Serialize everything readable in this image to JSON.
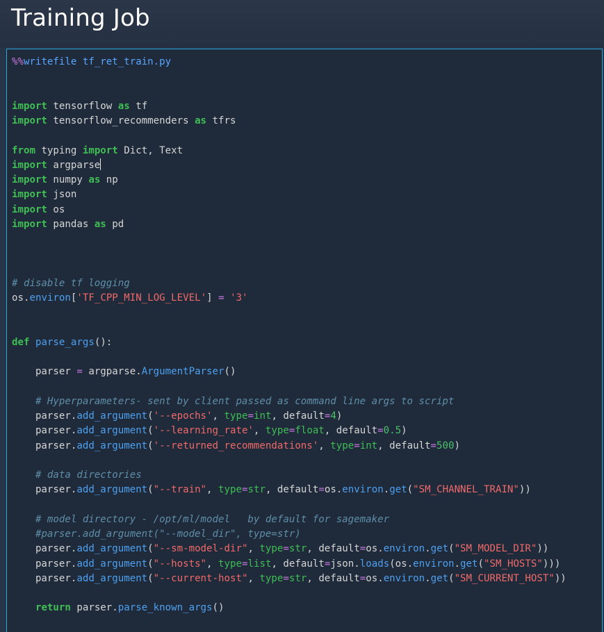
{
  "header": {
    "title": "Training Job"
  },
  "colors": {
    "background": "#283447",
    "cell_background": "#1f2a3a",
    "cell_border": "#2aa7d9",
    "keyword": "#3fbf54",
    "string": "#f06a6a",
    "comment": "#5f8fa8",
    "function": "#4ea1f0"
  },
  "code_cell": {
    "cursor_line": 7,
    "lines": [
      [
        [
          "magic",
          "%%"
        ],
        [
          "magicname",
          "writefile tf_ret_train.py"
        ]
      ],
      [],
      [],
      [
        [
          "kw",
          "import"
        ],
        [
          "plain",
          " tensorflow "
        ],
        [
          "kw",
          "as"
        ],
        [
          "plain",
          " tf"
        ]
      ],
      [
        [
          "kw",
          "import"
        ],
        [
          "plain",
          " tensorflow_recommenders "
        ],
        [
          "kw",
          "as"
        ],
        [
          "plain",
          " tfrs"
        ]
      ],
      [],
      [
        [
          "kw",
          "from"
        ],
        [
          "plain",
          " typing "
        ],
        [
          "kw",
          "import"
        ],
        [
          "plain",
          " Dict, Text"
        ]
      ],
      [
        [
          "kw",
          "import"
        ],
        [
          "plain",
          " argparse"
        ]
      ],
      [
        [
          "kw",
          "import"
        ],
        [
          "plain",
          " numpy "
        ],
        [
          "kw",
          "as"
        ],
        [
          "plain",
          " np"
        ]
      ],
      [
        [
          "kw",
          "import"
        ],
        [
          "plain",
          " json"
        ]
      ],
      [
        [
          "kw",
          "import"
        ],
        [
          "plain",
          " os"
        ]
      ],
      [
        [
          "kw",
          "import"
        ],
        [
          "plain",
          " pandas "
        ],
        [
          "kw",
          "as"
        ],
        [
          "plain",
          " pd"
        ]
      ],
      [],
      [],
      [],
      [
        [
          "comment",
          "# disable tf logging"
        ]
      ],
      [
        [
          "plain",
          "os"
        ],
        [
          "plain",
          "."
        ],
        [
          "fn",
          "environ"
        ],
        [
          "plain",
          "["
        ],
        [
          "str",
          "'TF_CPP_MIN_LOG_LEVEL'"
        ],
        [
          "plain",
          "] "
        ],
        [
          "op",
          "="
        ],
        [
          "plain",
          " "
        ],
        [
          "str",
          "'3'"
        ]
      ],
      [],
      [],
      [
        [
          "kw",
          "def"
        ],
        [
          "plain",
          " "
        ],
        [
          "fn",
          "parse_args"
        ],
        [
          "plain",
          "():"
        ]
      ],
      [],
      [
        [
          "plain",
          "    parser "
        ],
        [
          "op",
          "="
        ],
        [
          "plain",
          " argparse."
        ],
        [
          "fn",
          "ArgumentParser"
        ],
        [
          "plain",
          "()"
        ]
      ],
      [],
      [
        [
          "plain",
          "    "
        ],
        [
          "comment",
          "# Hyperparameters- sent by client passed as command line args to script"
        ]
      ],
      [
        [
          "plain",
          "    parser."
        ],
        [
          "fn",
          "add_argument"
        ],
        [
          "plain",
          "("
        ],
        [
          "str",
          "'--epochs'"
        ],
        [
          "plain",
          ", "
        ],
        [
          "builtin",
          "type"
        ],
        [
          "op",
          "="
        ],
        [
          "builtin",
          "int"
        ],
        [
          "plain",
          ", default"
        ],
        [
          "op",
          "="
        ],
        [
          "num",
          "4"
        ],
        [
          "plain",
          ")"
        ]
      ],
      [
        [
          "plain",
          "    parser."
        ],
        [
          "fn",
          "add_argument"
        ],
        [
          "plain",
          "("
        ],
        [
          "str",
          "'--learning_rate'"
        ],
        [
          "plain",
          ", "
        ],
        [
          "builtin",
          "type"
        ],
        [
          "op",
          "="
        ],
        [
          "builtin",
          "float"
        ],
        [
          "plain",
          ", default"
        ],
        [
          "op",
          "="
        ],
        [
          "num",
          "0.5"
        ],
        [
          "plain",
          ")"
        ]
      ],
      [
        [
          "plain",
          "    parser."
        ],
        [
          "fn",
          "add_argument"
        ],
        [
          "plain",
          "("
        ],
        [
          "str",
          "'--returned_recommendations'"
        ],
        [
          "plain",
          ", "
        ],
        [
          "builtin",
          "type"
        ],
        [
          "op",
          "="
        ],
        [
          "builtin",
          "int"
        ],
        [
          "plain",
          ", default"
        ],
        [
          "op",
          "="
        ],
        [
          "num",
          "500"
        ],
        [
          "plain",
          ")"
        ]
      ],
      [],
      [
        [
          "plain",
          "    "
        ],
        [
          "comment",
          "# data directories"
        ]
      ],
      [
        [
          "plain",
          "    parser."
        ],
        [
          "fn",
          "add_argument"
        ],
        [
          "plain",
          "("
        ],
        [
          "str",
          "\"--train\""
        ],
        [
          "plain",
          ", "
        ],
        [
          "builtin",
          "type"
        ],
        [
          "op",
          "="
        ],
        [
          "builtin",
          "str"
        ],
        [
          "plain",
          ", default"
        ],
        [
          "op",
          "="
        ],
        [
          "plain",
          "os."
        ],
        [
          "fn",
          "environ"
        ],
        [
          "plain",
          "."
        ],
        [
          "fn",
          "get"
        ],
        [
          "plain",
          "("
        ],
        [
          "str",
          "\"SM_CHANNEL_TRAIN\""
        ],
        [
          "plain",
          "))"
        ]
      ],
      [],
      [
        [
          "plain",
          "    "
        ],
        [
          "comment",
          "# model directory - /opt/ml/model   by default for sagemaker"
        ]
      ],
      [
        [
          "plain",
          "    "
        ],
        [
          "comment",
          "#parser.add_argument(\"--model_dir\", type=str)"
        ]
      ],
      [
        [
          "plain",
          "    parser."
        ],
        [
          "fn",
          "add_argument"
        ],
        [
          "plain",
          "("
        ],
        [
          "str",
          "\"--sm-model-dir\""
        ],
        [
          "plain",
          ", "
        ],
        [
          "builtin",
          "type"
        ],
        [
          "op",
          "="
        ],
        [
          "builtin",
          "str"
        ],
        [
          "plain",
          ", default"
        ],
        [
          "op",
          "="
        ],
        [
          "plain",
          "os."
        ],
        [
          "fn",
          "environ"
        ],
        [
          "plain",
          "."
        ],
        [
          "fn",
          "get"
        ],
        [
          "plain",
          "("
        ],
        [
          "str",
          "\"SM_MODEL_DIR\""
        ],
        [
          "plain",
          "))"
        ]
      ],
      [
        [
          "plain",
          "    parser."
        ],
        [
          "fn",
          "add_argument"
        ],
        [
          "plain",
          "("
        ],
        [
          "str",
          "\"--hosts\""
        ],
        [
          "plain",
          ", "
        ],
        [
          "builtin",
          "type"
        ],
        [
          "op",
          "="
        ],
        [
          "builtin",
          "list"
        ],
        [
          "plain",
          ", default"
        ],
        [
          "op",
          "="
        ],
        [
          "plain",
          "json."
        ],
        [
          "fn",
          "loads"
        ],
        [
          "plain",
          "(os."
        ],
        [
          "fn",
          "environ"
        ],
        [
          "plain",
          "."
        ],
        [
          "fn",
          "get"
        ],
        [
          "plain",
          "("
        ],
        [
          "str",
          "\"SM_HOSTS\""
        ],
        [
          "plain",
          ")))"
        ]
      ],
      [
        [
          "plain",
          "    parser."
        ],
        [
          "fn",
          "add_argument"
        ],
        [
          "plain",
          "("
        ],
        [
          "str",
          "\"--current-host\""
        ],
        [
          "plain",
          ", "
        ],
        [
          "builtin",
          "type"
        ],
        [
          "op",
          "="
        ],
        [
          "builtin",
          "str"
        ],
        [
          "plain",
          ", default"
        ],
        [
          "op",
          "="
        ],
        [
          "plain",
          "os."
        ],
        [
          "fn",
          "environ"
        ],
        [
          "plain",
          "."
        ],
        [
          "fn",
          "get"
        ],
        [
          "plain",
          "("
        ],
        [
          "str",
          "\"SM_CURRENT_HOST\""
        ],
        [
          "plain",
          "))"
        ]
      ],
      [],
      [
        [
          "plain",
          "    "
        ],
        [
          "kw",
          "return"
        ],
        [
          "plain",
          " parser."
        ],
        [
          "fn",
          "parse_known_args"
        ],
        [
          "plain",
          "()"
        ]
      ]
    ]
  }
}
